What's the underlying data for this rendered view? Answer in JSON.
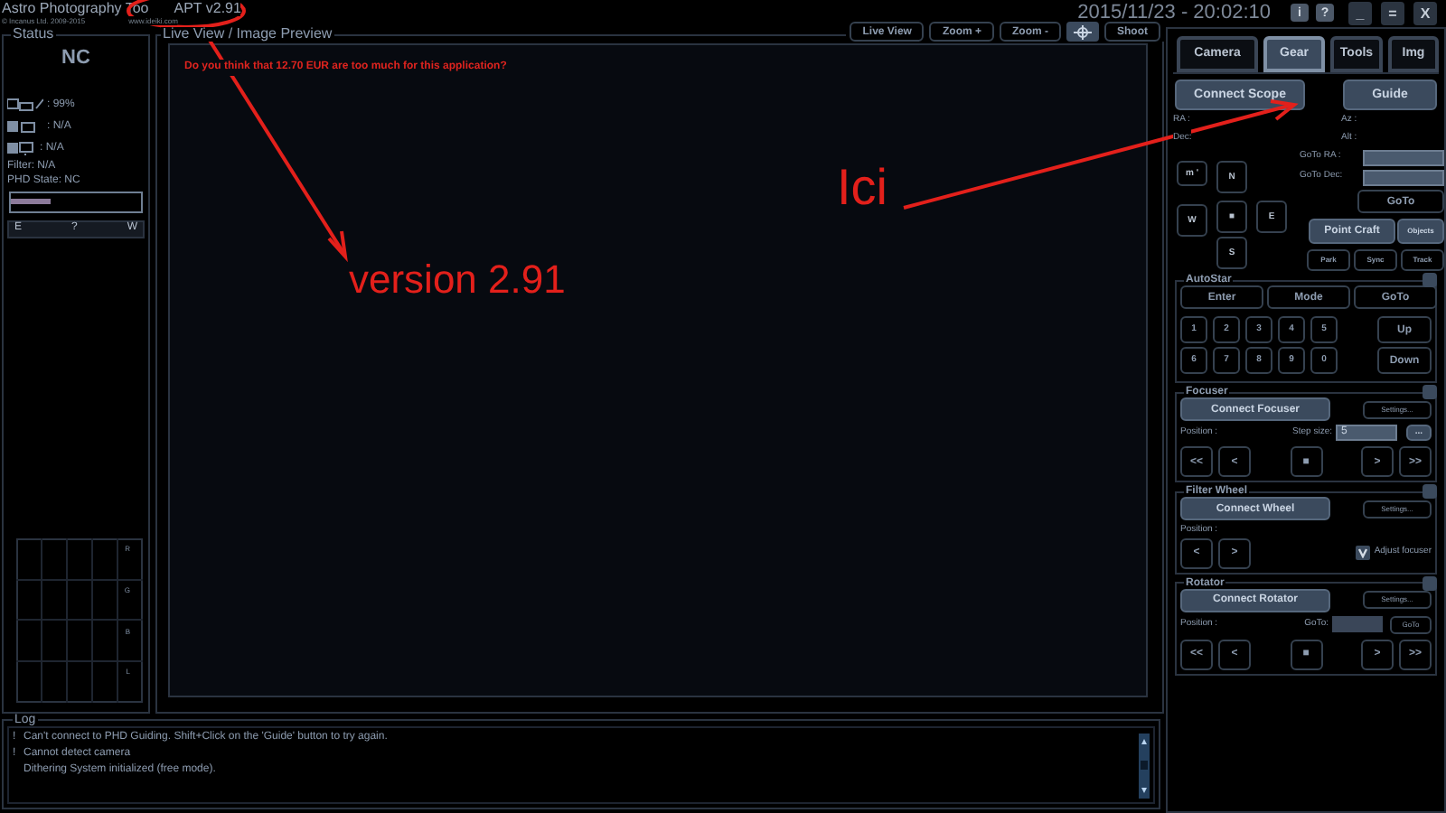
{
  "header": {
    "app_title": "Astro Photography Too",
    "version": "APT v2.91",
    "copyright": "© Incanus Ltd. 2009-2015",
    "website": "www.ideiki.com",
    "datetime": "2015/11/23 - 20:02:10",
    "window_buttons": [
      "i",
      "?",
      "_",
      "=",
      "X"
    ]
  },
  "status": {
    "title": "Status",
    "connection": "NC",
    "indicators": [
      {
        "kind": "battery",
        "text": ": 99%"
      },
      {
        "kind": "camera",
        "text": ": N/A"
      },
      {
        "kind": "monitor",
        "text": ": N/A"
      }
    ],
    "filter": "Filter: N/A",
    "phd_state": "PHD State: NC",
    "slider": {
      "level": 0.3
    },
    "compass": [
      "E",
      "?",
      "W"
    ],
    "histogram_labels": [
      "R",
      "G",
      "B",
      "L"
    ]
  },
  "preview": {
    "title": "Live View / Image Preview",
    "toolbar": [
      {
        "kind": "text",
        "label": "Live View"
      },
      {
        "kind": "text",
        "label": "Zoom +"
      },
      {
        "kind": "text",
        "label": "Zoom -"
      },
      {
        "kind": "crosshair"
      },
      {
        "kind": "text",
        "label": "Shoot"
      }
    ],
    "message": "Do you think that 12.70 EUR are too much for this application?"
  },
  "tabs": [
    {
      "label": "Camera",
      "selected": false
    },
    {
      "label": "Gear",
      "selected": true
    },
    {
      "label": "Tools",
      "selected": false
    },
    {
      "label": "Img",
      "selected": false
    }
  ],
  "scope": {
    "connect": "Connect Scope",
    "guide": "Guide",
    "coords": [
      "RA :",
      "Az :",
      "Dec:",
      "Alt :"
    ],
    "goto_fields": [
      "GoTo RA :",
      "GoTo Dec:"
    ],
    "pad": [
      "m '",
      "N",
      "W",
      "■",
      "E",
      "S"
    ],
    "goto": "GoTo",
    "point_craft": "Point Craft",
    "objects": "Objects",
    "mount_actions": [
      "Park",
      "Sync",
      "Track"
    ]
  },
  "groups": [
    {
      "kind": "autostar",
      "title": "AutoStar",
      "top": [
        "Enter",
        "Mode",
        "GoTo"
      ],
      "keys": [
        "1",
        "2",
        "3",
        "4",
        "5",
        "6",
        "7",
        "8",
        "9",
        "0"
      ],
      "side": [
        "Up",
        "Down"
      ]
    },
    {
      "kind": "focuser",
      "title": "Focuser",
      "connect": "Connect Focuser",
      "settings": "Settings...",
      "position": "Position :",
      "step_label": "Step size:",
      "step_value": "5",
      "more": "...",
      "moves": [
        "<<",
        "<",
        "■",
        ">",
        ">>"
      ]
    },
    {
      "kind": "filter_wheel",
      "title": "Filter Wheel",
      "connect": "Connect Wheel",
      "settings": "Settings...",
      "position": "Position :",
      "moves": [
        "<",
        ">"
      ],
      "adjust": {
        "label": "Adjust focuser",
        "checked": true
      }
    },
    {
      "kind": "rotator",
      "title": "Rotator",
      "connect": "Connect Rotator",
      "settings": "Settings...",
      "position": "Position :",
      "goto_label": "GoTo:",
      "goto_button": "GoTo",
      "moves": [
        "<<",
        "<",
        "■",
        ">",
        ">>"
      ]
    }
  ],
  "log": {
    "title": "Log",
    "lines": [
      {
        "mark": "!",
        "text": "Can't connect to PHD Guiding. Shift+Click on the 'Guide' button to try again."
      },
      {
        "mark": "!",
        "text": "Cannot detect camera"
      },
      {
        "text": "Dithering System initialized (free mode)."
      }
    ]
  },
  "annotations": [
    {
      "kind": "label",
      "text": "version 2.91"
    },
    {
      "kind": "label",
      "text": "Ici"
    }
  ]
}
